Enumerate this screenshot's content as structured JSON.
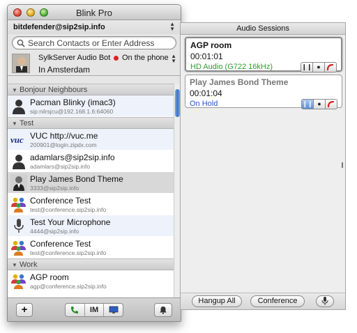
{
  "window": {
    "title": "Blink Pro"
  },
  "account": {
    "label": "bitdefender@sip2sip.info"
  },
  "search": {
    "placeholder": "Search Contacts or Enter Address"
  },
  "me": {
    "name": "SylkServer Audio Bot",
    "status": "On the phone",
    "location": "In Amsterdam",
    "status_color": "#e02020"
  },
  "groups": [
    {
      "label": "Bonjour Neighbours",
      "contacts": [
        {
          "name": "Pacman Blinky (imac3)",
          "addr": "sip:nilrsjcu@192.168.1.6:64060",
          "icon": "person-silhouette-icon"
        }
      ]
    },
    {
      "label": "Test",
      "contacts": [
        {
          "name": "VUC http://vuc.me",
          "addr": "200901@login.zipdx.com",
          "icon": "vuc-logo-icon"
        },
        {
          "name": "adamlars@sip2sip.info",
          "addr": "adamlars@sip2sip.info",
          "icon": "person-silhouette-icon"
        },
        {
          "name": "Play James Bond Theme",
          "addr": "3333@sip2sip.info",
          "icon": "james-bond-icon"
        },
        {
          "name": "Conference Test",
          "addr": "test@conference.sip2sip.info",
          "icon": "conference-people-icon"
        },
        {
          "name": "Test Your Microphone",
          "addr": "4444@sip2sip.info",
          "icon": "microphone-icon"
        },
        {
          "name": "Conference Test",
          "addr": "test@conference.sip2sip.info",
          "icon": "conference-people-icon"
        }
      ]
    },
    {
      "label": "Work",
      "contacts": [
        {
          "name": "AGP room",
          "addr": "agp@conference.sip2sip.info",
          "icon": "conference-people-icon"
        }
      ]
    }
  ],
  "bottom_bar": {
    "add_label": "+",
    "im_label": "IM"
  },
  "audio": {
    "title": "Audio Sessions",
    "sessions": [
      {
        "name": "AGP room",
        "time": "00:01:01",
        "status": "HD Audio (G722 16kHz)",
        "status_color": "#2e9e2e"
      },
      {
        "name": "Play James Bond Theme",
        "time": "00:01:04",
        "status": "On Hold",
        "status_color": "#2a55c9"
      }
    ],
    "hangup_all_label": "Hangup All",
    "conference_label": "Conference"
  }
}
